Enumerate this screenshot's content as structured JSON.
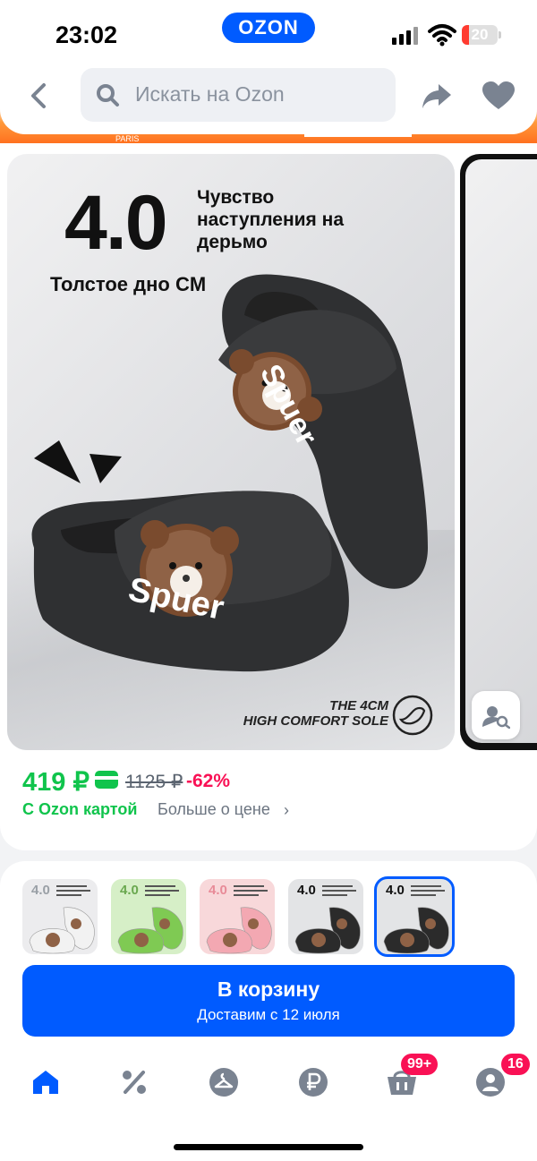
{
  "status_bar": {
    "time": "23:02",
    "app_logo": "OZON",
    "battery_level": "20",
    "battery_fraction": 0.2,
    "icons": [
      "cellular-signal-icon",
      "wifi-icon",
      "battery-icon"
    ]
  },
  "header": {
    "search_placeholder": "Искать на Ozon",
    "icons": [
      "back-arrow-icon",
      "search-icon",
      "share-icon",
      "heart-icon"
    ],
    "banner_fragment": "PARIS"
  },
  "product_image": {
    "promo_number": "4.0",
    "promo_text": "Чувство наступления на дерьмо",
    "promo_subtitle": "Толстое дно CM",
    "comfort_line1": "THE 4CM",
    "comfort_line2": "HIGH COMFORT SOLE",
    "brand_on_slipper": "Spuer"
  },
  "price": {
    "current": "419 ₽",
    "old": "1125 ₽",
    "discount": "-62%",
    "ozon_card_label": "С Ozon картой",
    "more_about_price": "Больше о цене",
    "more_chevron": "›"
  },
  "variants": [
    {
      "number": "4.0",
      "color_name": "white",
      "bg": "#ececee",
      "shoe": "#f2f2f2",
      "num_color": "#9aa0a6",
      "selected": false
    },
    {
      "number": "4.0",
      "color_name": "green",
      "bg": "#d6efc7",
      "shoe": "#7fca53",
      "num_color": "#6aa84f",
      "selected": false
    },
    {
      "number": "4.0",
      "color_name": "pink",
      "bg": "#f8d8da",
      "shoe": "#f3a8b2",
      "num_color": "#e88b98",
      "selected": false
    },
    {
      "number": "4.0",
      "color_name": "black",
      "bg": "#e3e4e6",
      "shoe": "#2b2b2b",
      "num_color": "#111111",
      "selected": false
    },
    {
      "number": "4.0",
      "color_name": "black",
      "bg": "#e3e4e6",
      "shoe": "#2b2b2b",
      "num_color": "#111111",
      "selected": true
    }
  ],
  "cart_button": {
    "title": "В корзину",
    "subtitle": "Доставим с 12 июля"
  },
  "bottom_nav": {
    "items": [
      "home-icon",
      "discount-icon",
      "catalog-hanger-icon",
      "ruble-finance-icon",
      "cart-icon",
      "profile-icon"
    ],
    "cart_badge": "99+",
    "profile_badge": "16"
  },
  "colors": {
    "brand_blue": "#005bff",
    "price_green": "#10c44c",
    "discount_pink": "#f91155",
    "header_orange": "#ff6a1a"
  }
}
